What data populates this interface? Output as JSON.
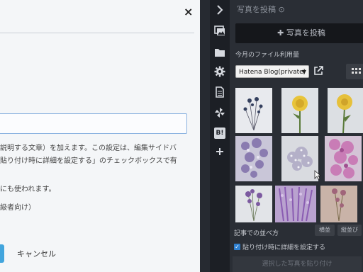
{
  "modal": {
    "close_label": "×",
    "caption_value": "",
    "description_lines": [
      "説明する文章）を加えます。この設定は、編集サイドバ",
      "貼り付け時に詳細を設定する」のチェックボックスで有"
    ],
    "note_1": "にも使われます。",
    "note_2": "級者向け）",
    "cancel_label": "キャンセル"
  },
  "iconbar": {
    "items": [
      "chevron-right-icon",
      "photo-icon",
      "folder-icon",
      "gear-icon",
      "document-icon",
      "pinwheel-icon",
      "hatena-bookmark-icon",
      "plus-icon"
    ],
    "hatena_bookmark_label": "B!"
  },
  "panel": {
    "title": "写真を投稿 ⊙",
    "post_button_label": "写真を投稿",
    "usage_label": "今月のファイル利用量",
    "folder_select_value": "Hatena Blog(private)",
    "thumbnails": [
      "dried-flower-photo-1",
      "yellow-rose-photo-1",
      "yellow-rose-photo-2",
      "purple-flower-photo-1",
      "baby-breath-photo",
      "pink-flower-photo",
      "purple-statice-photo",
      "lavender-bunch-photo",
      "dried-flower-photo-2"
    ],
    "sort_label": "記事での並べ方",
    "sort_options": [
      "横並",
      "縦並び"
    ],
    "detail_checkbox_checked": true,
    "detail_checkbox_label": "貼り付け時に詳細を設定する",
    "paste_button_label": "選択した写真を貼り付け"
  },
  "colors": {
    "accent_blue": "#42a5dd",
    "panel_bg": "#2a2e35",
    "iconbar_bg": "#1c1f25",
    "modal_bg": "#f4f6f8"
  }
}
